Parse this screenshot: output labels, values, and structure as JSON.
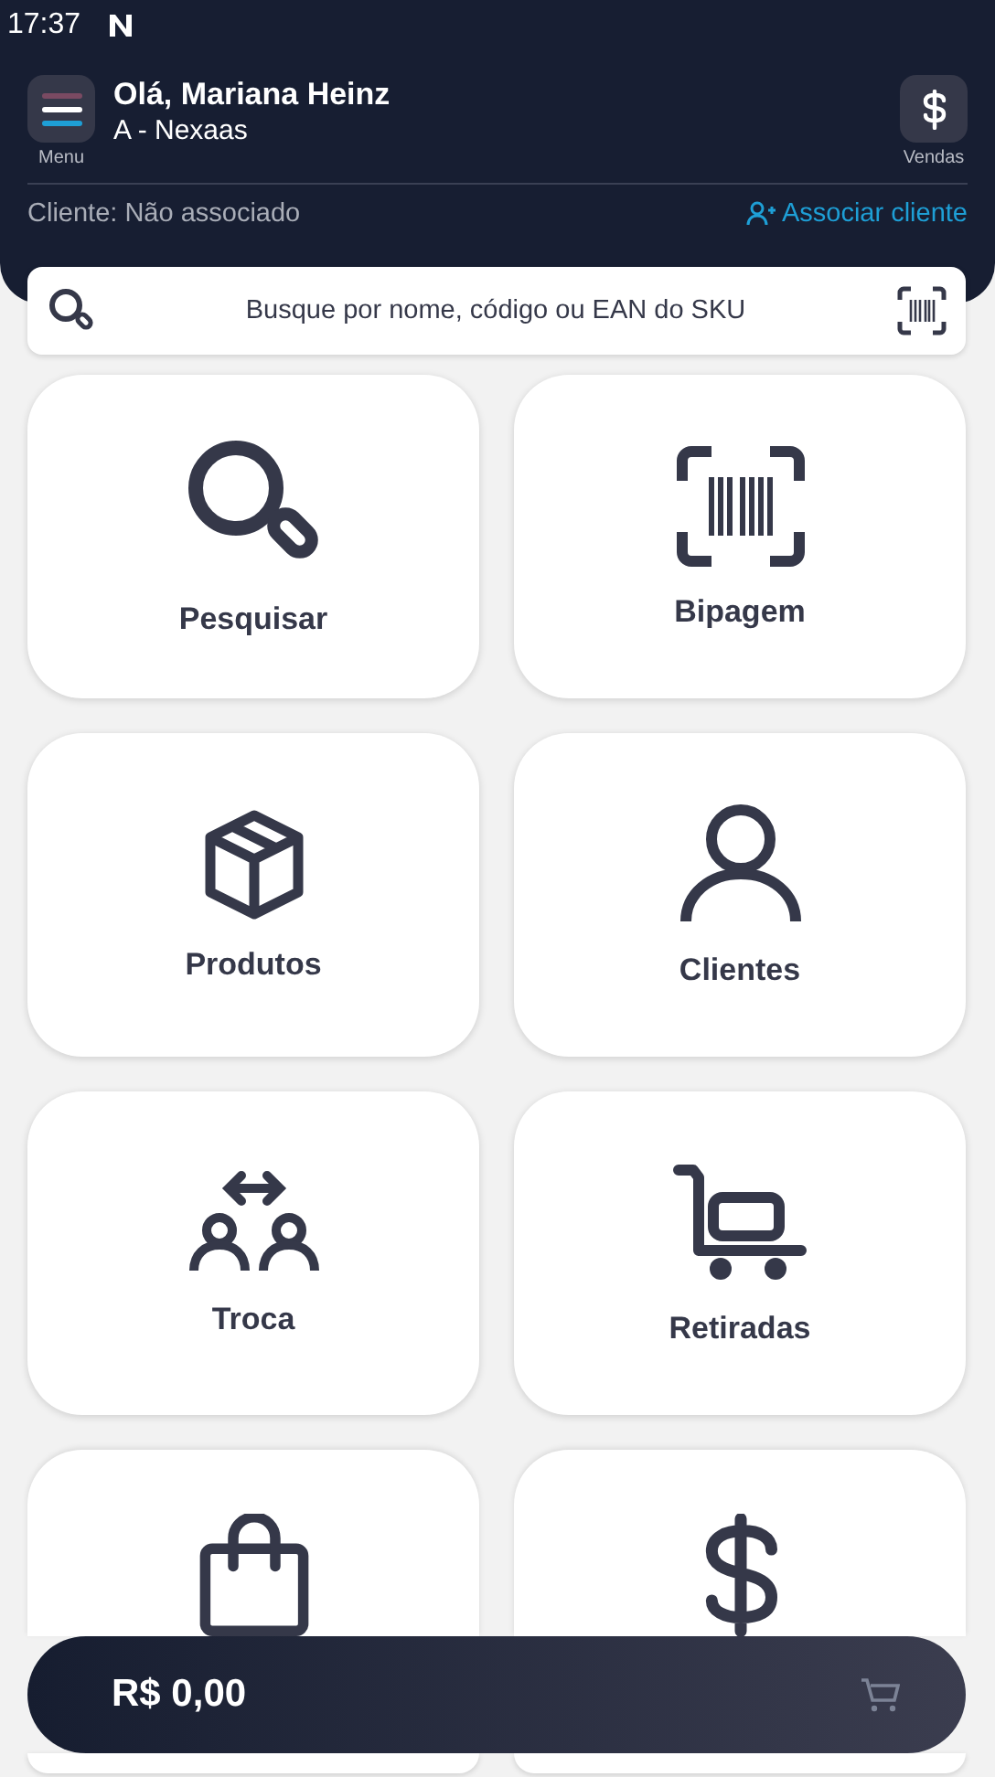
{
  "status_bar": {
    "time": "17:37"
  },
  "header": {
    "menu_label": "Menu",
    "greeting": "Olá, Mariana Heinz",
    "store": "A - Nexaas",
    "sales_label": "Vendas",
    "client_status": "Cliente: Não associado",
    "associate_link": "Associar cliente"
  },
  "search": {
    "placeholder": "Busque por nome, código ou EAN do SKU"
  },
  "tiles": [
    {
      "kind": "search",
      "label": "Pesquisar"
    },
    {
      "kind": "scan",
      "label": "Bipagem"
    },
    {
      "kind": "box",
      "label": "Produtos"
    },
    {
      "kind": "person",
      "label": "Clientes"
    },
    {
      "kind": "swap",
      "label": "Troca"
    },
    {
      "kind": "cart",
      "label": "Retiradas"
    },
    {
      "kind": "bag"
    },
    {
      "kind": "money"
    }
  ],
  "cart_bar": {
    "total": "R$ 0,00"
  }
}
